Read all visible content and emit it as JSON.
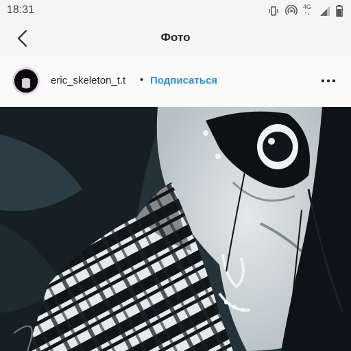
{
  "status_bar": {
    "time": "18:31",
    "network_type": "4G",
    "network_arrows": "↑↓",
    "icons": [
      "vibrate-icon",
      "hotspot-icon",
      "network-4g-icon",
      "signal-icon",
      "battery-icon"
    ]
  },
  "header": {
    "title": "Фото",
    "back_icon": "chevron-left-icon"
  },
  "post": {
    "username": "eric_skeleton_t.t",
    "separator": "•",
    "follow_label": "Подписаться",
    "more_icon": "more-horizontal-icon"
  },
  "colors": {
    "follow_link": "#2d8fcf",
    "header_bg": "#f5f5f5",
    "post_header_bg": "#fafafa",
    "text": "#262626",
    "avatar_ring": "#e4c9ec"
  }
}
